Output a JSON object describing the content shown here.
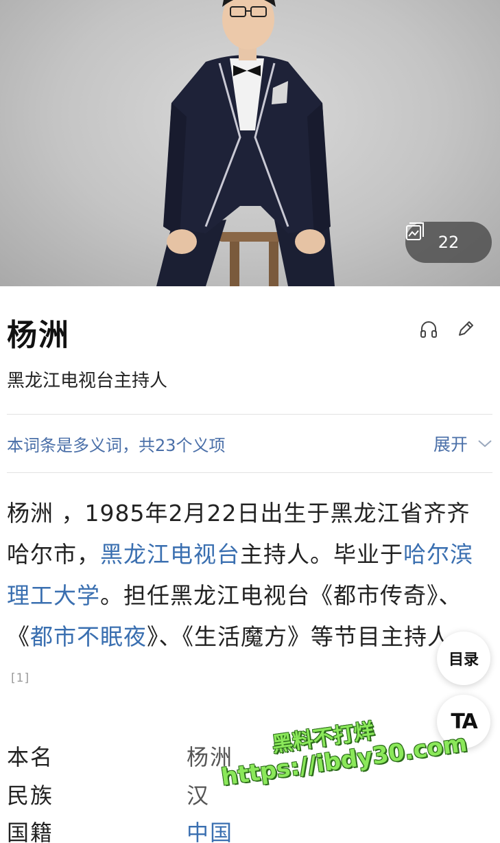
{
  "hero": {
    "gallery_count": "22"
  },
  "header": {
    "title": "杨洲",
    "subtitle": "黑龙江电视台主持人"
  },
  "polysemy": {
    "text": "本词条是多义词，共23个义项",
    "expand_label": "展开"
  },
  "summary": {
    "t1": "杨洲 ，1985年2月22日出生于黑龙江省齐齐哈尔市，",
    "link1": "黑龙江电视台",
    "t2": "主持人。毕业于",
    "link2": "哈尔滨理工大学",
    "t3": "。担任黑龙江电视台《都市传奇》、《",
    "link3": "都市不眠夜",
    "t4": "》、《生活魔方》等节目主持人。",
    "ref": "[1]"
  },
  "floating": {
    "toc_label": "目录",
    "ta_label": "TA"
  },
  "info": [
    {
      "key": "本名",
      "value": "杨洲"
    },
    {
      "key": "民族",
      "value": "汉"
    },
    {
      "key": "国籍",
      "value": "中国"
    }
  ],
  "watermark": {
    "line1": "黑料不打烊",
    "line2": "https://ibdy30.com"
  },
  "colors": {
    "link": "#3a6fb0",
    "polysemy": "#4a6fa8",
    "watermark": "#8be85a"
  }
}
